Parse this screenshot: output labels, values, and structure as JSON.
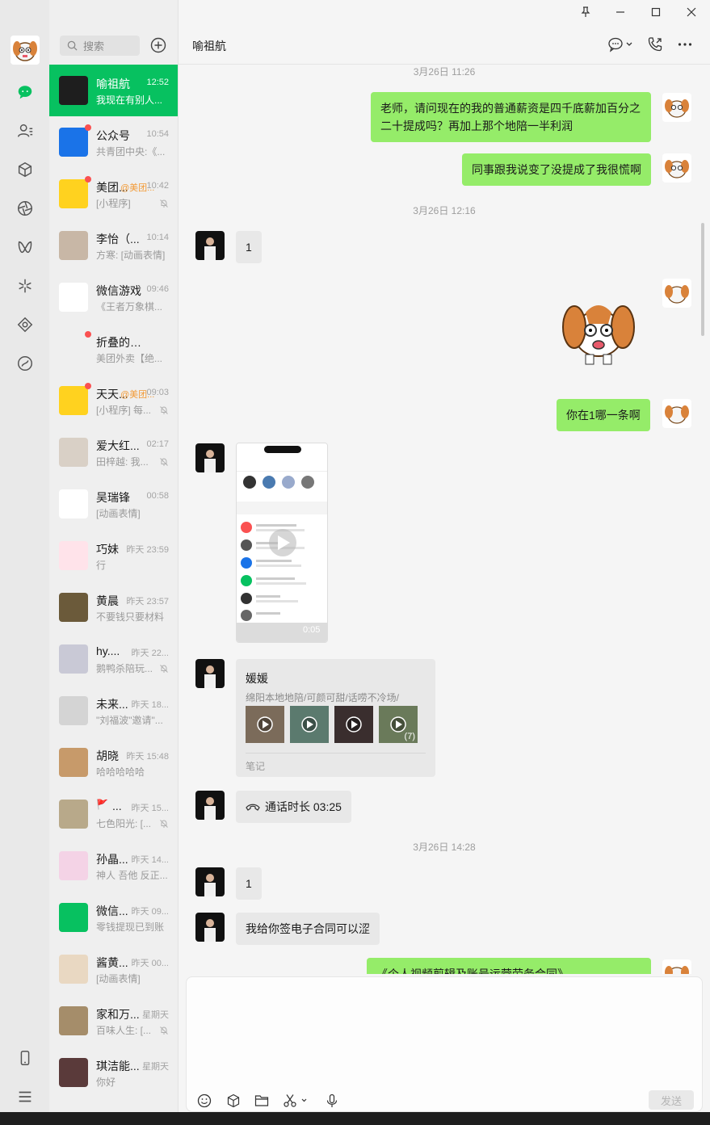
{
  "search": {
    "placeholder": "搜索"
  },
  "chats": [
    {
      "name": "喻祖航",
      "time": "12:52",
      "preview": "我现在有别人...",
      "active": true,
      "dot": false,
      "mute": false,
      "avatar": "#1e1e1e"
    },
    {
      "name": "公众号",
      "time": "10:54",
      "preview": "共青团中央:《...",
      "dot": true,
      "mute": false,
      "avatar": "#1a73e8"
    },
    {
      "name": "美团...",
      "time": "10:42",
      "preview": "[小程序]",
      "tag": "@美团...",
      "dot": true,
      "mute": true,
      "avatar": "#ffd21f"
    },
    {
      "name": "李怡（...",
      "time": "10:14",
      "preview": "方寒: [动画表情]",
      "dot": false,
      "mute": false,
      "avatar": "#c8b7a6"
    },
    {
      "name": "微信游戏",
      "time": "09:46",
      "preview": "《王者万象棋...",
      "dot": false,
      "mute": false,
      "avatar": "#ffffff"
    },
    {
      "name": "折叠的聊天",
      "time": "",
      "preview": "美团外卖【绝...",
      "dot": true,
      "mute": false,
      "avatar": "#efefef"
    },
    {
      "name": "天天...",
      "time": "09:03",
      "preview": "[小程序] 每...",
      "tag": "@美团...",
      "dot": true,
      "mute": true,
      "avatar": "#ffd21f"
    },
    {
      "name": "爱大红...",
      "time": "02:17",
      "preview": "田梓越: 我...",
      "dot": false,
      "mute": true,
      "avatar": "#d9d0c6"
    },
    {
      "name": "吴瑞锋",
      "time": "00:58",
      "preview": "[动画表情]",
      "dot": false,
      "mute": false,
      "avatar": "#ffffff"
    },
    {
      "name": "巧妹",
      "time": "昨天 23:59",
      "preview": "行",
      "dot": false,
      "mute": false,
      "avatar": "#ffe3ea"
    },
    {
      "name": "黄晨",
      "time": "昨天 23:57",
      "preview": "不要钱只要材料",
      "dot": false,
      "mute": false,
      "avatar": "#6b5a3a"
    },
    {
      "name": "hy....",
      "time": "昨天 22...",
      "preview": "鹅鸭杀陪玩...",
      "dot": false,
      "mute": true,
      "avatar": "#c9c9d6"
    },
    {
      "name": "未来...",
      "time": "昨天 18...",
      "preview": "\"刘福波\"邀请\"...",
      "dot": false,
      "mute": false,
      "avatar": "#d4d4d4"
    },
    {
      "name": "胡晓",
      "time": "昨天 15:48",
      "preview": "哈哈哈哈哈",
      "dot": false,
      "mute": false,
      "avatar": "#c79a6a"
    },
    {
      "name": "...",
      "time": "昨天 15...",
      "preview": "七色阳光: [...",
      "flag": "🚩",
      "dot": false,
      "mute": true,
      "avatar": "#b8a98a"
    },
    {
      "name": "孙晶...",
      "time": "昨天 14...",
      "preview": "神人 吾他 反正...",
      "dot": false,
      "mute": false,
      "avatar": "#f4d3e6"
    },
    {
      "name": "微信...",
      "time": "昨天 09...",
      "preview": "零钱提现已到账",
      "dot": false,
      "mute": false,
      "avatar": "#07c160"
    },
    {
      "name": "酱黄...",
      "time": "昨天 00...",
      "preview": "[动画表情]",
      "dot": false,
      "mute": false,
      "avatar": "#e9d8c2"
    },
    {
      "name": "家和万...",
      "time": "星期天",
      "preview": "百味人生: [...",
      "dot": false,
      "mute": true,
      "avatar": "#a58d6a"
    },
    {
      "name": "琪洁能...",
      "time": "星期天",
      "preview": "你好",
      "dot": false,
      "mute": false,
      "avatar": "#5a3a3a"
    }
  ],
  "header": {
    "title": "喻祖航"
  },
  "messages": {
    "ts1": "3月26日 11:26",
    "m1": "老师，请问现在的我的普通薪资是四千底薪加百分之二十提成吗？再加上那个地陪一半利润",
    "m2": "同事跟我说变了没提成了我很慌啊",
    "ts2": "3月26日 12:16",
    "m3": "1",
    "m4": "你在1哪一条啊",
    "video_duration": "0:05",
    "note_title": "媛媛",
    "note_desc": "绵阳本地地陪/可颜可甜/话唠不冷场/",
    "note_count": "(7)",
    "note_source": "笔记",
    "call": "通话时长 03:25",
    "ts3": "3月26日 14:28",
    "m5": "1",
    "m6": "我给你签电子合同可以涩",
    "m7": "《个人视频剪辑及账号运营劳务合同》"
  },
  "input": {
    "send_label": "发送"
  }
}
